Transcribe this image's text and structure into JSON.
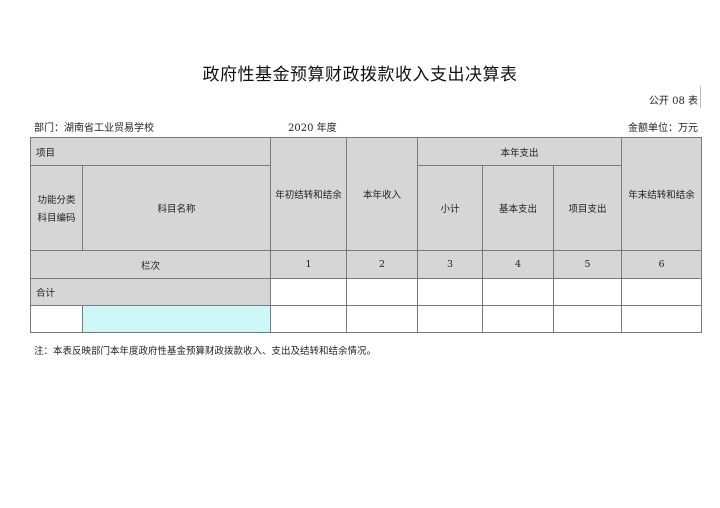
{
  "document": {
    "title": "政府性基金预算财政拨款收入支出决算表",
    "form_no": "公开 08 表",
    "department": "部门：湖南省工业贸易学校",
    "year": "2020",
    "year_suffix": " 年度",
    "unit": "金额单位：万元"
  },
  "table": {
    "header": {
      "item": "项目",
      "func_class_line1": "功能分类",
      "func_class_line2": "科目编码",
      "subject_name": "科目名称",
      "opening_balance": "年初结转和结余",
      "income": "本年收入",
      "expense_group": "本年支出",
      "subtotal": "小计",
      "basic_expense": "基本支出",
      "project_expense": "项目支出",
      "closing_balance": "年末结转和结余"
    },
    "column_row": {
      "label": "栏次",
      "numbers": [
        "1",
        "2",
        "3",
        "4",
        "5",
        "6"
      ]
    },
    "total_row": {
      "label": "合计"
    }
  },
  "footnote": "注：本表反映部门本年度政府性基金预算财政拨款收入、支出及结转和结余情况。"
}
